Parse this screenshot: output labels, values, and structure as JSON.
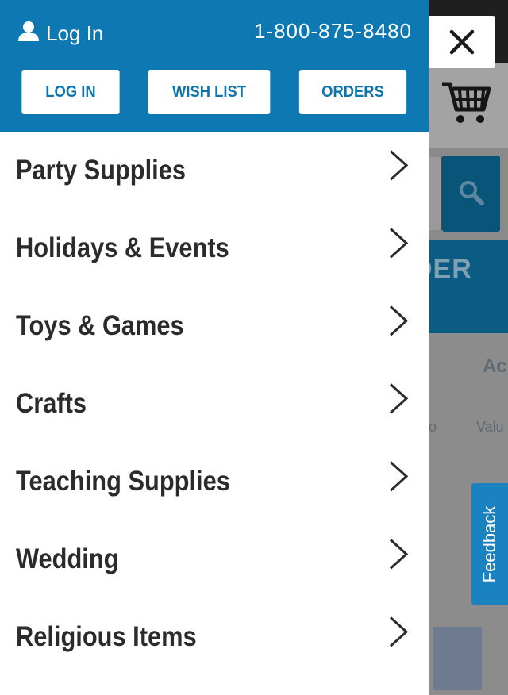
{
  "drawer": {
    "header": {
      "login_link": "Log In",
      "phone": "1-800-875-8480",
      "buttons": {
        "login": "LOG IN",
        "wishlist": "WISH LIST",
        "orders": "ORDERS"
      }
    },
    "menu": [
      {
        "label": "Party Supplies"
      },
      {
        "label": "Holidays & Events"
      },
      {
        "label": "Toys & Games"
      },
      {
        "label": "Crafts"
      },
      {
        "label": "Teaching Supplies"
      },
      {
        "label": "Wedding"
      },
      {
        "label": "Religious Items"
      }
    ]
  },
  "background": {
    "banner_fragment": "DER",
    "fragments": [
      "Ac",
      "o",
      "Valu"
    ]
  },
  "feedback": {
    "label": "Feedback"
  },
  "colors": {
    "brand_blue": "#0e78b3",
    "feedback_blue": "#1a82bf",
    "menu_text": "#2b2b2b"
  },
  "icons": [
    "user-icon",
    "cart-icon",
    "search-icon",
    "close-icon",
    "chevron-right-icon"
  ]
}
